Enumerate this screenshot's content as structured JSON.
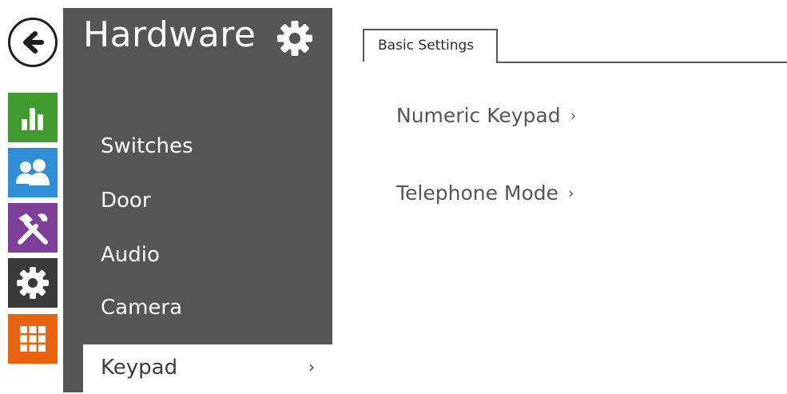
{
  "rail": {
    "items": [
      {
        "icon": "back-arrow-icon"
      },
      {
        "icon": "bar-chart-icon",
        "color": "#3f9b2e"
      },
      {
        "icon": "users-icon",
        "color": "#2f8fd6"
      },
      {
        "icon": "tools-icon",
        "color": "#7d3f9a"
      },
      {
        "icon": "gear-icon",
        "color": "#3a3a3a"
      },
      {
        "icon": "grid-icon",
        "color": "#e8630e"
      }
    ]
  },
  "sidebar": {
    "title": "Hardware",
    "background": "#555555",
    "items": [
      {
        "label": "Switches"
      },
      {
        "label": "Door"
      },
      {
        "label": "Audio"
      },
      {
        "label": "Camera"
      },
      {
        "label": "Keypad",
        "chevron": "›",
        "active": true
      }
    ]
  },
  "tabs": [
    {
      "label": "Basic Settings",
      "active": true
    }
  ],
  "content": {
    "links": [
      {
        "label": "Numeric Keypad",
        "arrow": "›"
      },
      {
        "label": "Telephone Mode",
        "arrow": "›"
      }
    ]
  }
}
